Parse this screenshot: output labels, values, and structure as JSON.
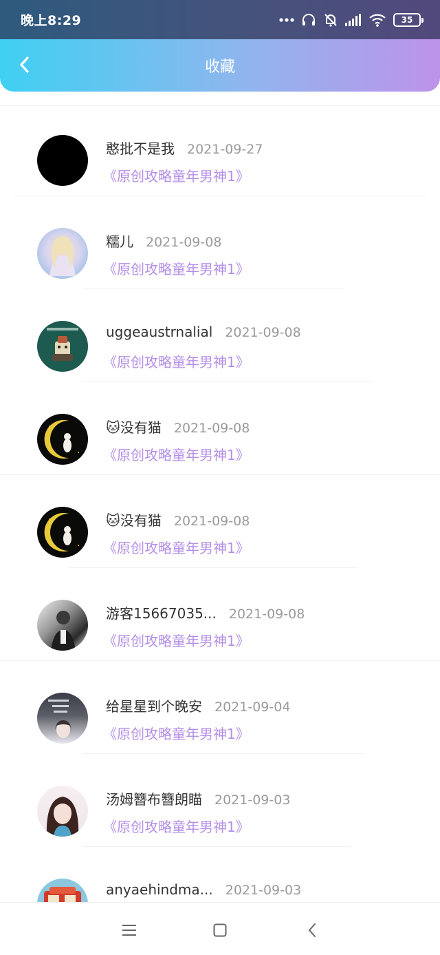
{
  "status_bar": {
    "time": "晚上8:29",
    "battery": "35",
    "icons": [
      "more-dots-icon",
      "headset-icon",
      "bell-muted-icon",
      "signal-icon",
      "wifi-icon",
      "battery-icon"
    ]
  },
  "header": {
    "title": "收藏",
    "back_icon": "back-arrow-icon",
    "colors": {
      "gradient_start": "#3fd0f2",
      "gradient_end": "#bd93ea"
    }
  },
  "favorites": [
    {
      "user": "憨批不是我",
      "date": "2021-09-27",
      "title": "《原创攻略童年男神1》",
      "avatar": "black-circle"
    },
    {
      "user": "糯儿",
      "date": "2021-09-08",
      "title": "《原创攻略童年男神1》",
      "avatar": "anime-girl"
    },
    {
      "user": "uggeaustrnalial",
      "date": "2021-09-08",
      "title": "《原创攻略童年男神1》",
      "avatar": "robot-cartoon"
    },
    {
      "user": "🐱没有猫",
      "date": "2021-09-08",
      "title": "《原创攻略童年男神1》",
      "avatar": "moon-cat"
    },
    {
      "user": "🐱没有猫",
      "date": "2021-09-08",
      "title": "《原创攻略童年男神1》",
      "avatar": "moon-cat"
    },
    {
      "user": "游客15667035...",
      "date": "2021-09-08",
      "title": "《原创攻略童年男神1》",
      "avatar": "man-photo"
    },
    {
      "user": "给星星到个晚安",
      "date": "2021-09-04",
      "title": "《原创攻略童年男神1》",
      "avatar": "girl-text"
    },
    {
      "user": "汤姆簪布簪朗瞄",
      "date": "2021-09-03",
      "title": "《原创攻略童年男神1》",
      "avatar": "girl-photo"
    },
    {
      "user": "anyaehindma...",
      "date": "2021-09-03",
      "title": "",
      "avatar": "red-vehicle"
    }
  ],
  "nav_buttons": [
    "menu-icon",
    "home-square-icon",
    "back-triangle-icon"
  ],
  "colors": {
    "link": "#b58ee8",
    "username": "#333333",
    "date": "#9a9a9a"
  }
}
